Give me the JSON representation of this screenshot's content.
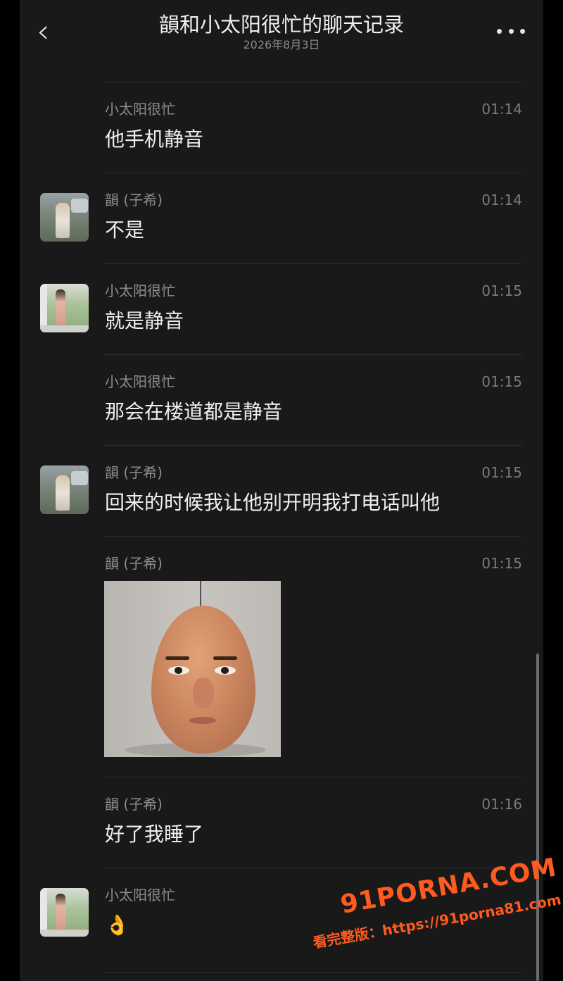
{
  "header": {
    "back_icon": "chevron-left-icon",
    "back_glyph": "‹",
    "title": "韻和小太阳很忙的聊天记录",
    "subtitle": "2026年8月3日",
    "more_icon": "more-dots-icon"
  },
  "messages": [
    {
      "sender": "小太阳很忙",
      "time": "01:14",
      "text": "他手机静音",
      "avatar": ""
    },
    {
      "sender": "韻 (子希)",
      "time": "01:14",
      "text": "不是",
      "avatar": "photo-avatar-man"
    },
    {
      "sender": "小太阳很忙",
      "time": "01:15",
      "text": "就是静音",
      "avatar": "photo-avatar-woman"
    },
    {
      "sender": "小太阳很忙",
      "time": "01:15",
      "text": "那会在楼道都是静音",
      "avatar": ""
    },
    {
      "sender": "韻 (子希)",
      "time": "01:15",
      "text": "回来的时候我让他别开明我打电话叫他",
      "avatar": "photo-avatar-man"
    },
    {
      "sender": "韻 (子希)",
      "time": "01:15",
      "image": "egg-face-sticker",
      "avatar": ""
    },
    {
      "sender": "韻 (子希)",
      "time": "01:16",
      "text": "好了我睡了",
      "avatar": ""
    },
    {
      "sender": "小太阳很忙",
      "time": "",
      "text": "👌",
      "avatar": "photo-avatar-woman"
    }
  ],
  "watermark": {
    "brand": "91PORNA.COM",
    "url_text": "看完整版：https://91porna81.com",
    "color": "#ff5a1f"
  }
}
